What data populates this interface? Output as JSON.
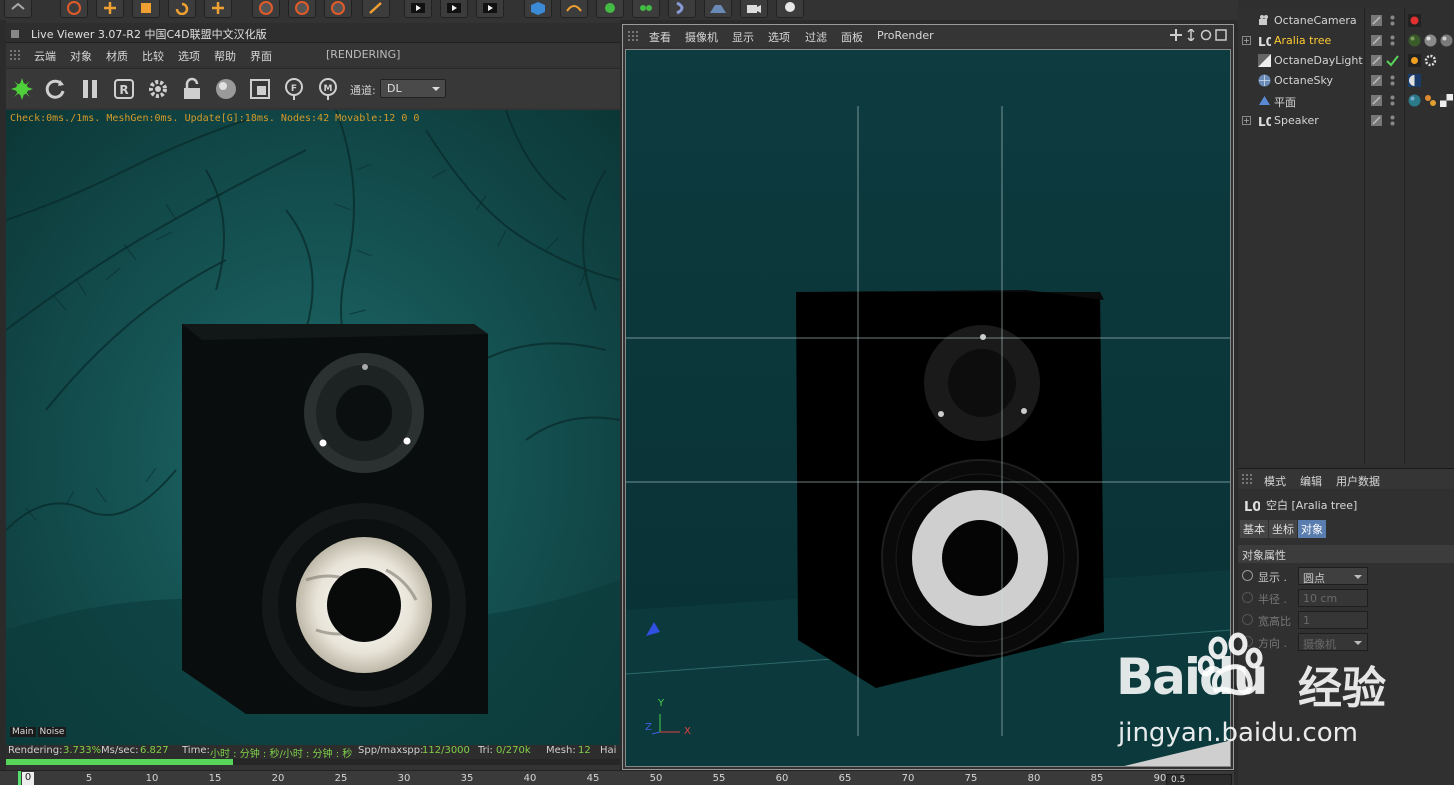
{
  "live_viewer": {
    "title": "Live Viewer 3.07-R2 中国C4D联盟中文汉化版",
    "menu": [
      "云端",
      "对象",
      "材质",
      "比较",
      "选项",
      "帮助",
      "界面"
    ],
    "render_state": "[RENDERING]",
    "channel_label": "通道:",
    "channel_value": "DL",
    "stats": "Check:0ms./1ms. MeshGen:0ms. Update[G]:18ms. Nodes:42 Movable:12  0 0",
    "pass_tabs": [
      "Main",
      "Noise"
    ],
    "status": {
      "rendering_label": "Rendering:",
      "rendering_value": "3.733%",
      "mssec_label": "Ms/sec:",
      "mssec_value": "6.827",
      "time_label": "Time:",
      "time_value": "小时 : 分钟 : 秒/小时 : 分钟 : 秒",
      "spp_label": "Spp/maxspp:",
      "spp_value": "112/3000",
      "tri_label": "Tri:",
      "tri_value": "0/270k",
      "mesh_label": "Mesh:",
      "mesh_value": "12",
      "hair_label": "Hai"
    },
    "progress": 0.037
  },
  "viewport": {
    "menu": [
      "查看",
      "摄像机",
      "显示",
      "选项",
      "过滤",
      "面板",
      "ProRender"
    ],
    "axis_labels": {
      "x": "X",
      "y": "Y",
      "z": "Z"
    }
  },
  "timeline": {
    "ticks": [
      "0",
      "5",
      "10",
      "15",
      "20",
      "25",
      "30",
      "35",
      "40",
      "45",
      "50",
      "55",
      "60",
      "65",
      "70",
      "75",
      "80",
      "85",
      "90"
    ],
    "current": "0",
    "field_value": "0.5"
  },
  "objects": [
    {
      "name": "OctaneCamera",
      "icon": "camera-icon",
      "selected": false,
      "expandable": false
    },
    {
      "name": "Aralia tree",
      "icon": "null-icon",
      "selected": true,
      "expandable": true
    },
    {
      "name": "OctaneDayLight",
      "icon": "light-icon",
      "selected": false,
      "expandable": false
    },
    {
      "name": "OctaneSky",
      "icon": "sky-icon",
      "selected": false,
      "expandable": false
    },
    {
      "name": "平面",
      "icon": "plane-icon",
      "selected": false,
      "expandable": false
    },
    {
      "name": "Speaker",
      "icon": "null-icon",
      "selected": false,
      "expandable": true
    }
  ],
  "attributes": {
    "menu": [
      "模式",
      "编辑",
      "用户数据"
    ],
    "header": "空白 [Aralia tree]",
    "tabs": [
      "基本",
      "坐标",
      "对象"
    ],
    "active_tab": "对象",
    "section": "对象属性",
    "props": [
      {
        "label": "显示 .",
        "value": "圆点",
        "enabled": true,
        "dropdown": true
      },
      {
        "label": "半径 .",
        "value": "10 cm",
        "enabled": false,
        "dropdown": false
      },
      {
        "label": "宽高比",
        "value": "1",
        "enabled": false,
        "dropdown": false
      },
      {
        "label": "方向 .",
        "value": "摄像机",
        "enabled": false,
        "dropdown": true
      }
    ]
  },
  "watermark": {
    "logo": "Baidu",
    "brand": "经验",
    "url": "jingyan.baidu.com"
  },
  "colors": {
    "accent_green": "#57d45a",
    "stats_orange": "#d49a2a",
    "selected_yellow": "#ffcc33",
    "scene_teal": "#155252"
  }
}
